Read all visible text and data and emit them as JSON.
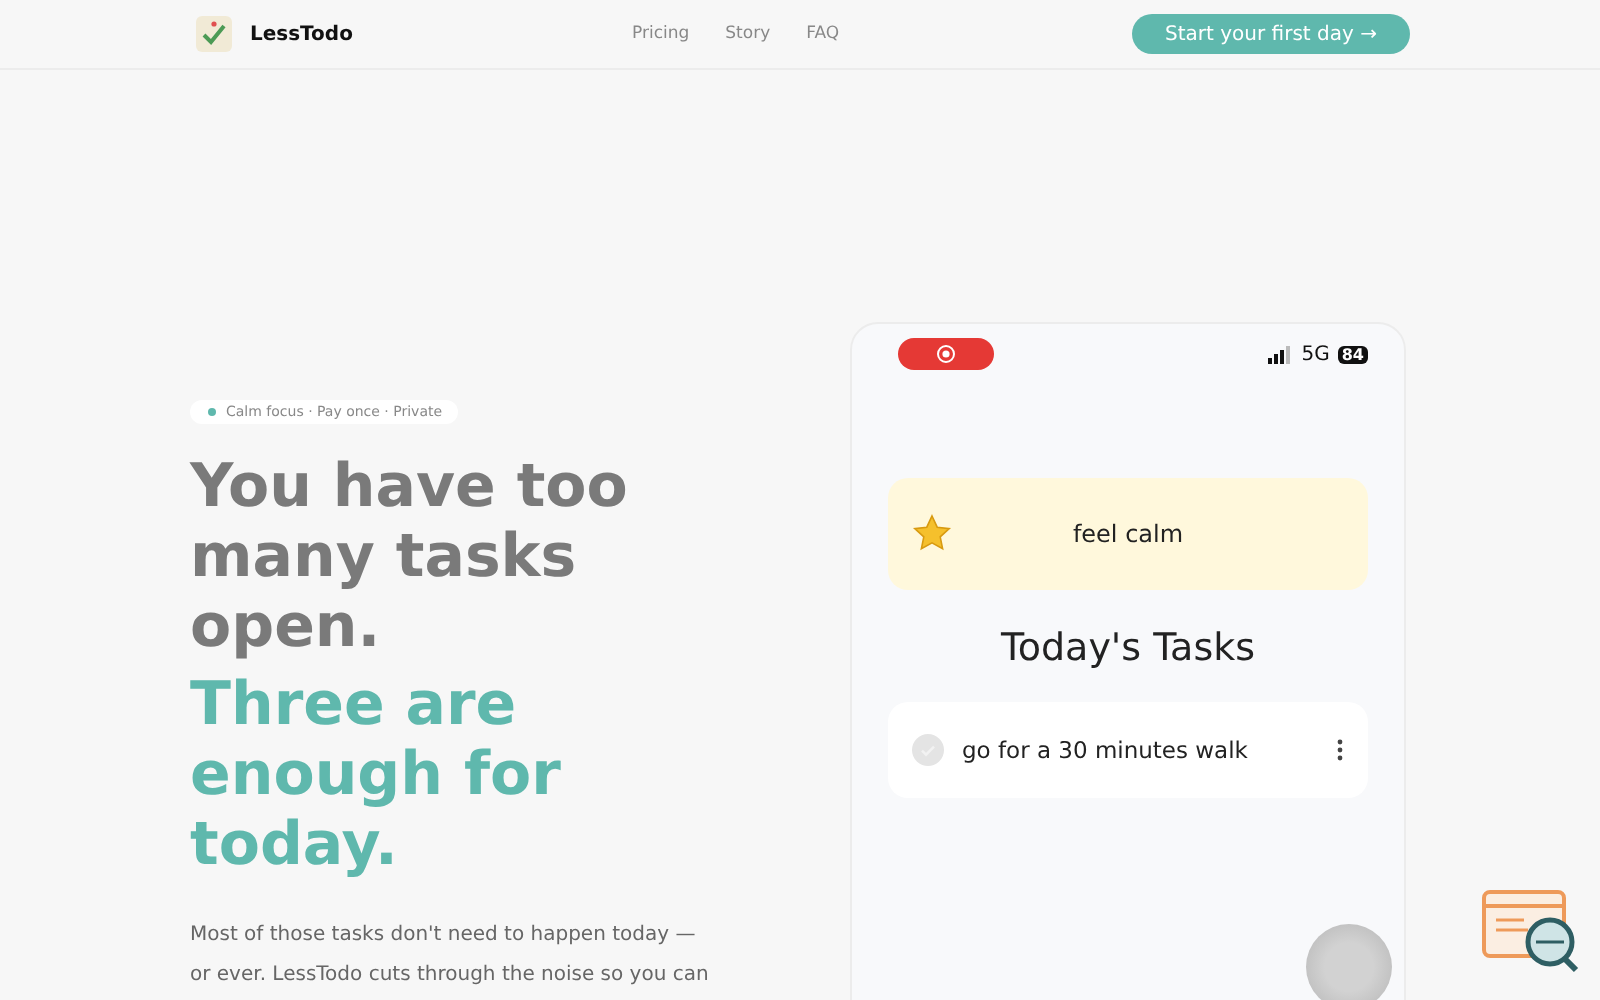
{
  "header": {
    "brand": "LessTodo",
    "nav": [
      {
        "label": "Pricing"
      },
      {
        "label": "Story"
      },
      {
        "label": "FAQ"
      }
    ],
    "cta": "Start your first day →"
  },
  "hero": {
    "badge": "Calm focus · Pay once · Private",
    "headline_lines": [
      "You have too",
      "many tasks",
      "open."
    ],
    "accent_lines": [
      "Three are",
      "enough for",
      "today."
    ],
    "paragraph_lines": [
      "Most of those tasks don't need to happen today —",
      "or ever. LessTodo cuts through the noise so you can"
    ]
  },
  "phone": {
    "status": {
      "network": "5G",
      "battery": "84"
    },
    "quote": {
      "text": "feel calm"
    },
    "title": "Today's Tasks",
    "tasks": [
      {
        "text": "go for a 30 minutes walk",
        "done": false
      }
    ]
  }
}
